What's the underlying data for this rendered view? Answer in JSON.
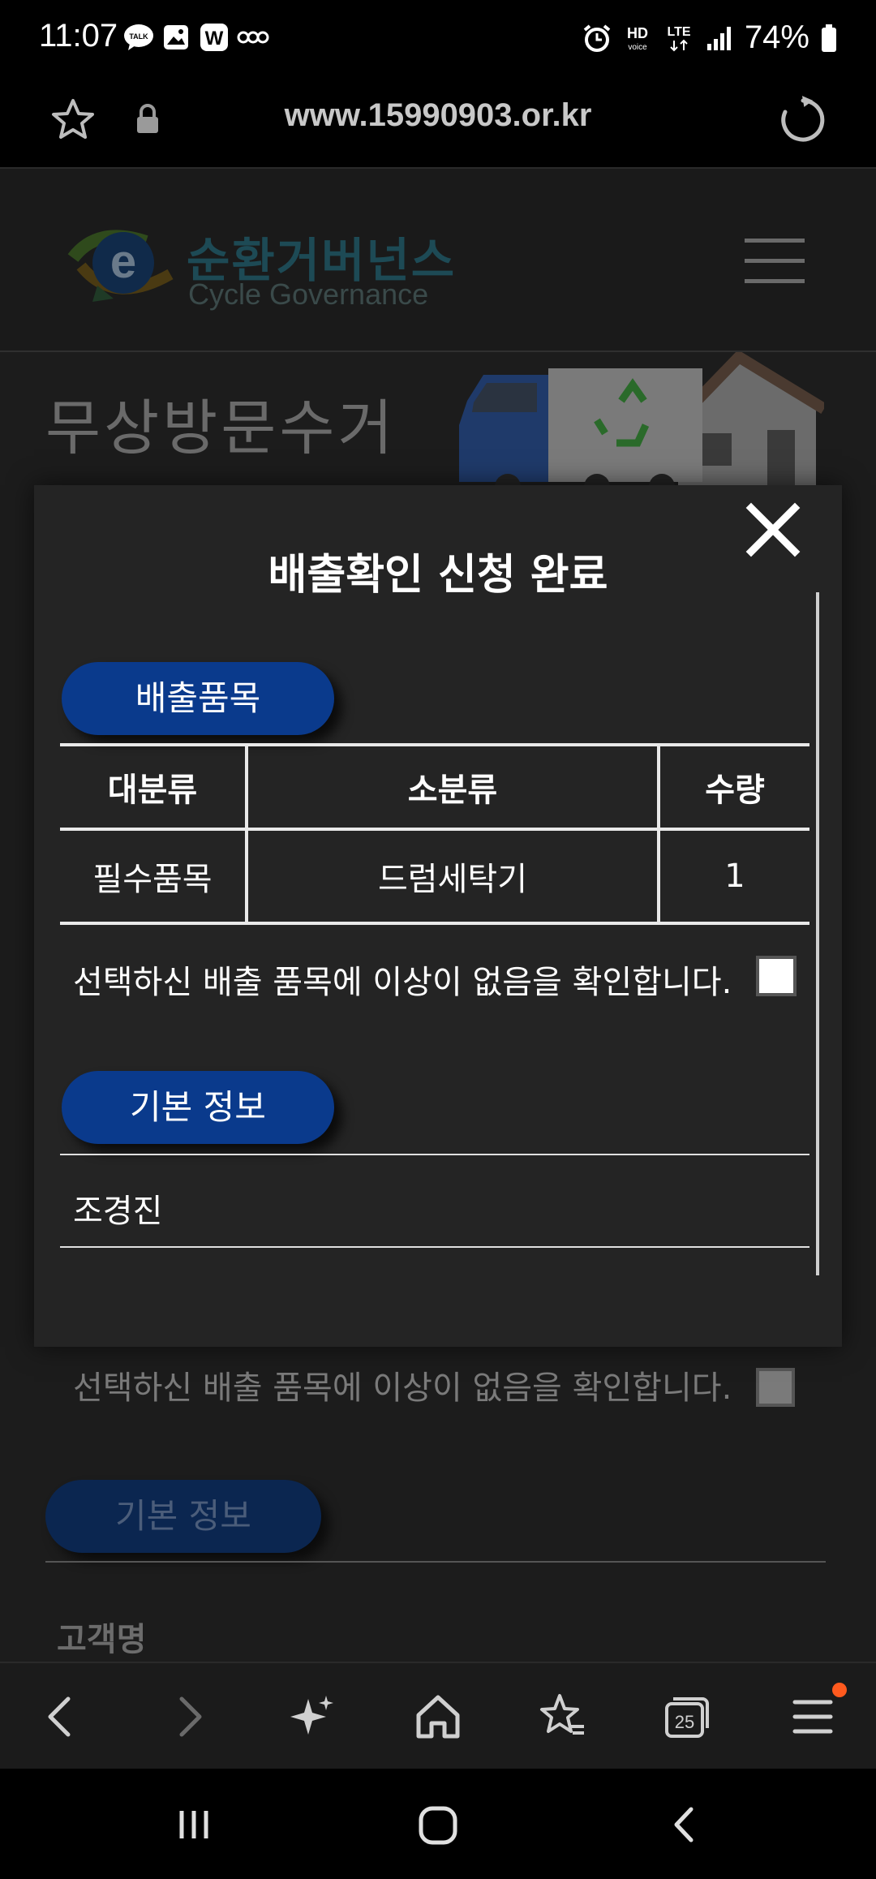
{
  "status_bar": {
    "time": "11:07",
    "network": "LTE",
    "battery": "74%",
    "icons": [
      "talk-notification-icon",
      "gallery-notification-icon",
      "w-app-icon",
      "alarm-icon",
      "hd-voice-icon",
      "lte-icon",
      "signal-icon",
      "battery-icon"
    ]
  },
  "url_bar": {
    "url": "www.15990903.or.kr"
  },
  "site": {
    "logo_ko": "순환거버넌스",
    "logo_en": "Cycle Governance",
    "banner_title": "무상방문수거"
  },
  "modal": {
    "title": "배출확인 신청 완료",
    "items_section_label": "배출품목",
    "table": {
      "headers": [
        "대분류",
        "소분류",
        "수량"
      ],
      "rows": [
        [
          "필수품목",
          "드럼세탁기",
          "1"
        ]
      ]
    },
    "confirm_text": "선택하신 배출 품목에 이상이 없음을 확인합니다.",
    "confirm_checked": false,
    "info_section_label": "기본 정보",
    "customer_name": "조경진"
  },
  "background": {
    "confirm_text": "선택하신 배출 품목에 이상이 없음을 확인합니다.",
    "info_section_label": "기본 정보",
    "customer_label": "고객명"
  },
  "colors": {
    "accent_blue": "#0a3a8c",
    "modal_bg": "#242424",
    "notification_dot": "#ff5a1e"
  }
}
